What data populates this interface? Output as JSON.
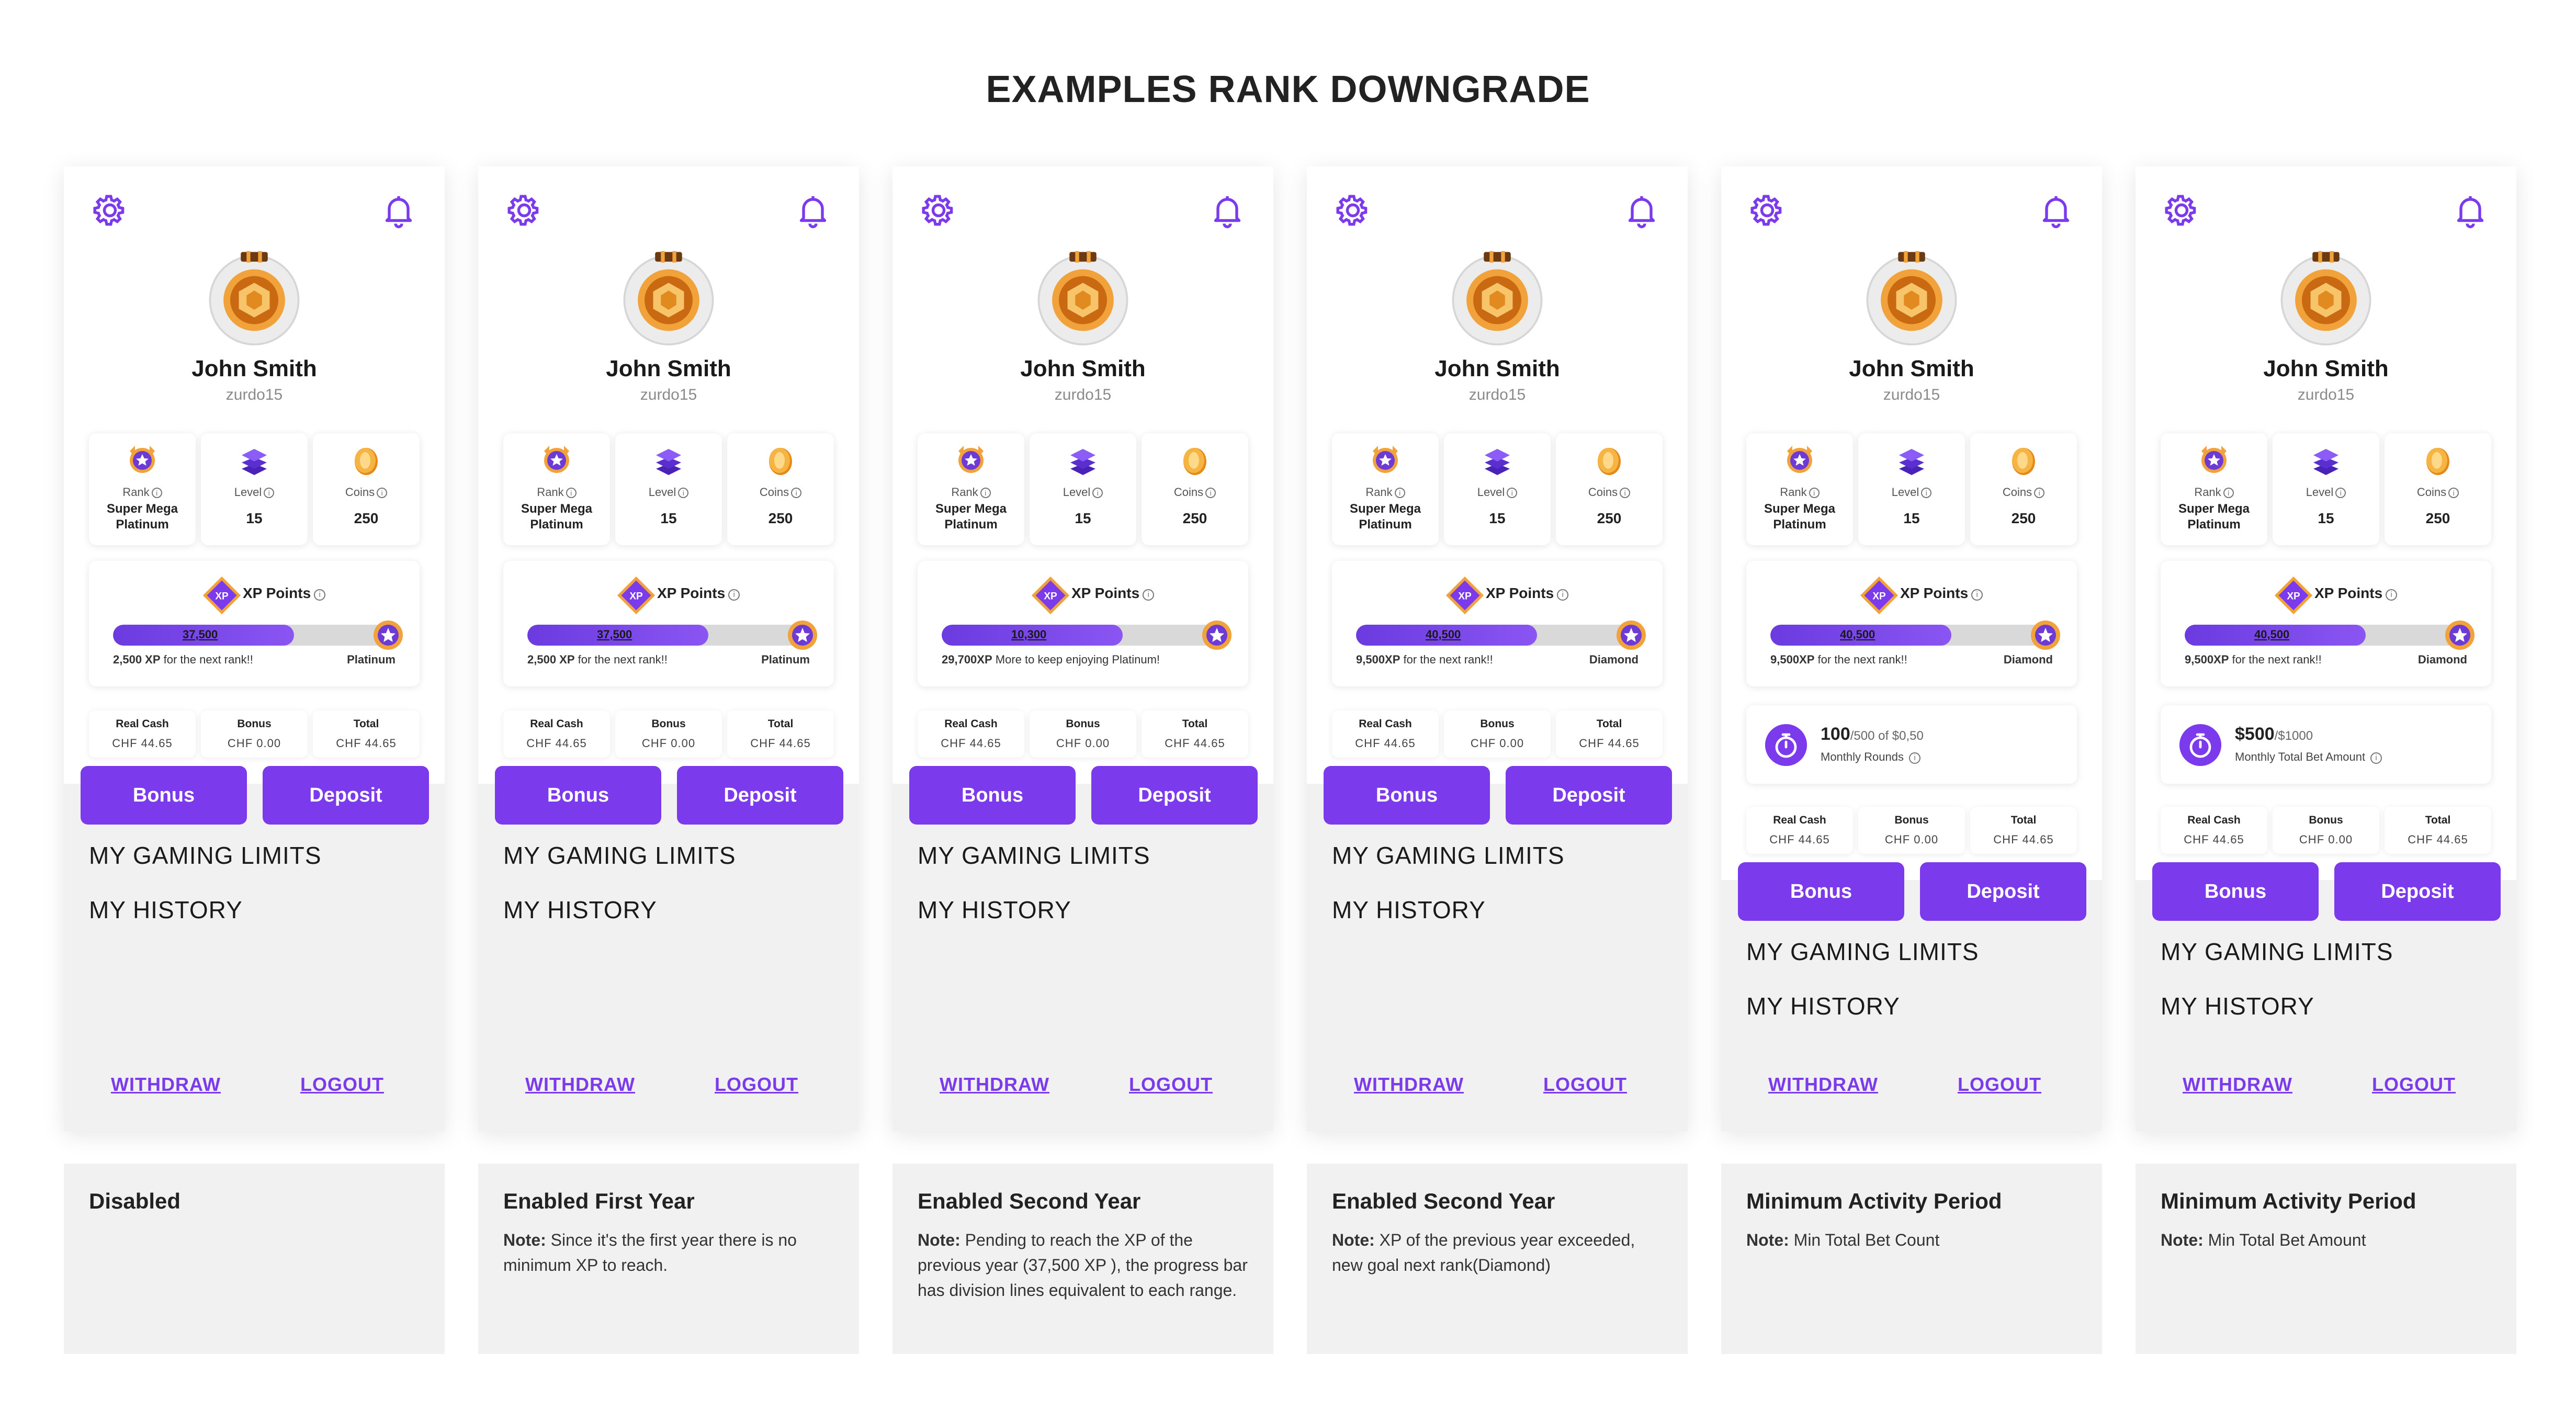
{
  "title": "EXAMPLES RANK DOWNGRADE",
  "colors": {
    "accent": "#7c3aed",
    "panel": "#f1f1f1",
    "gold": "#f2a23a"
  },
  "icons": [
    "gear-icon",
    "bell-icon",
    "rank-badge-icon",
    "level-stack-icon",
    "coin-icon",
    "xp-badge-icon",
    "stopwatch-icon"
  ],
  "profile": {
    "name": "John Smith",
    "handle": "zurdo15"
  },
  "stats": {
    "rank_label": "Rank",
    "rank_value_1": "Super Mega",
    "rank_value_2": "Platinum",
    "level_label": "Level",
    "level_value": "15",
    "coins_label": "Coins",
    "coins_value": "250",
    "info_glyph": "i"
  },
  "xp_title": "XP Points",
  "balances": {
    "real_label": "Real Cash",
    "real_value": "CHF 44.65",
    "bonus_label": "Bonus",
    "bonus_value": "CHF 0.00",
    "total_label": "Total",
    "total_value": "CHF 44.65"
  },
  "buttons": {
    "bonus": "Bonus",
    "deposit": "Deposit"
  },
  "menu": {
    "limits": "MY GAMING LIMITS",
    "history": "MY HISTORY"
  },
  "links": {
    "withdraw": "WITHDRAW",
    "logout": "LOGOUT"
  },
  "screens": [
    {
      "xp_value": "37,500",
      "xp_progress": 0.65,
      "xp_note_bold": "2,500 XP",
      "xp_note": " for the next rank!!",
      "next_rank": "Platinum",
      "note_title": "Disabled",
      "note_label": "",
      "note_text": ""
    },
    {
      "xp_value": "37,500",
      "xp_progress": 0.65,
      "xp_note_bold": "2,500 XP",
      "xp_note": " for the next rank!!",
      "next_rank": "Platinum",
      "note_title": "Enabled First Year",
      "note_label": "Note:",
      "note_text": " Since it's the first year there is no minimum XP to reach."
    },
    {
      "xp_value": "10,300",
      "xp_progress": 0.65,
      "xp_note_bold": "29,700XP",
      "xp_note": " More to keep enjoying Platinum!",
      "next_rank": "",
      "note_title": "Enabled Second Year",
      "note_label": "Note:",
      "note_text": " Pending to reach the XP of the previous year (37,500 XP ), the progress bar has division lines equivalent to each range."
    },
    {
      "xp_value": "40,500",
      "xp_progress": 0.65,
      "xp_note_bold": "9,500XP",
      "xp_note": " for the next rank!!",
      "next_rank": "Diamond",
      "note_title": "Enabled Second Year",
      "note_label": "Note:",
      "note_text": " XP of the previous year exceeded, new goal next rank(Diamond)"
    },
    {
      "xp_value": "40,500",
      "xp_progress": 0.65,
      "xp_note_bold": "9,500XP",
      "xp_note": " for the next rank!!",
      "next_rank": "Diamond",
      "activity_main": "100",
      "activity_suffix": "/500 of $0,50",
      "activity_sub": "Monthly Rounds",
      "note_title": "Minimum Activity Period",
      "note_label": "Note:",
      "note_text": " Min Total Bet Count"
    },
    {
      "xp_value": "40,500",
      "xp_progress": 0.65,
      "xp_note_bold": "9,500XP",
      "xp_note": " for the next rank!!",
      "next_rank": "Diamond",
      "activity_main": "$500",
      "activity_suffix": "/$1000",
      "activity_sub": "Monthly Total Bet Amount",
      "note_title": "Minimum Activity Period",
      "note_label": "Note:",
      "note_text": " Min Total Bet Amount"
    }
  ]
}
